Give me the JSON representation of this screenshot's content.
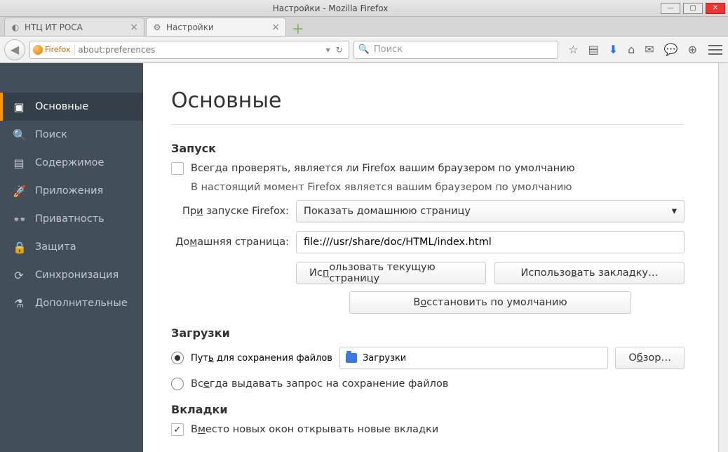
{
  "window": {
    "title": "Настройки - Mozilla Firefox"
  },
  "tabs": [
    {
      "label": "НТЦ ИТ РОСА",
      "active": false
    },
    {
      "label": "Настройки",
      "active": true
    }
  ],
  "urlbar": {
    "identity": "Firefox",
    "url": "about:preferences",
    "dropdown_hint": "▾"
  },
  "searchbar": {
    "placeholder": "Поиск"
  },
  "sidebar": {
    "items": [
      {
        "label": "Основные",
        "icon": "general-icon",
        "active": true
      },
      {
        "label": "Поиск",
        "icon": "search-icon",
        "active": false
      },
      {
        "label": "Содержимое",
        "icon": "content-icon",
        "active": false
      },
      {
        "label": "Приложения",
        "icon": "applications-icon",
        "active": false
      },
      {
        "label": "Приватность",
        "icon": "privacy-icon",
        "active": false
      },
      {
        "label": "Защита",
        "icon": "security-icon",
        "active": false
      },
      {
        "label": "Синхронизация",
        "icon": "sync-icon",
        "active": false
      },
      {
        "label": "Дополнительные",
        "icon": "advanced-icon",
        "active": false
      }
    ]
  },
  "page": {
    "heading": "Основные",
    "startup": {
      "title": "Запуск",
      "check_default_label": "Всегда проверять, является ли Firefox вашим браузером по умолчанию",
      "default_status": "В настоящий момент Firefox является вашим браузером по умолчанию",
      "on_startup_label": "При запуске Firefox:",
      "on_startup_value": "Показать домашнюю страницу",
      "homepage_label": "Домашняя страница:",
      "homepage_value": "file:///usr/share/doc/HTML/index.html",
      "use_current_btn": "Использовать текущую страницу",
      "use_bookmark_btn": "Использовать закладку…",
      "restore_default_btn": "Восстановить по умолчанию"
    },
    "downloads": {
      "title": "Загрузки",
      "save_to_label": "Путь для сохранения файлов",
      "save_to_path": "Загрузки",
      "browse_btn": "Обзор…",
      "always_ask_label": "Всегда выдавать запрос на сохранение файлов"
    },
    "tabs_section": {
      "title": "Вкладки",
      "open_new_tabs_label": "Вместо новых окон открывать новые вкладки"
    }
  }
}
